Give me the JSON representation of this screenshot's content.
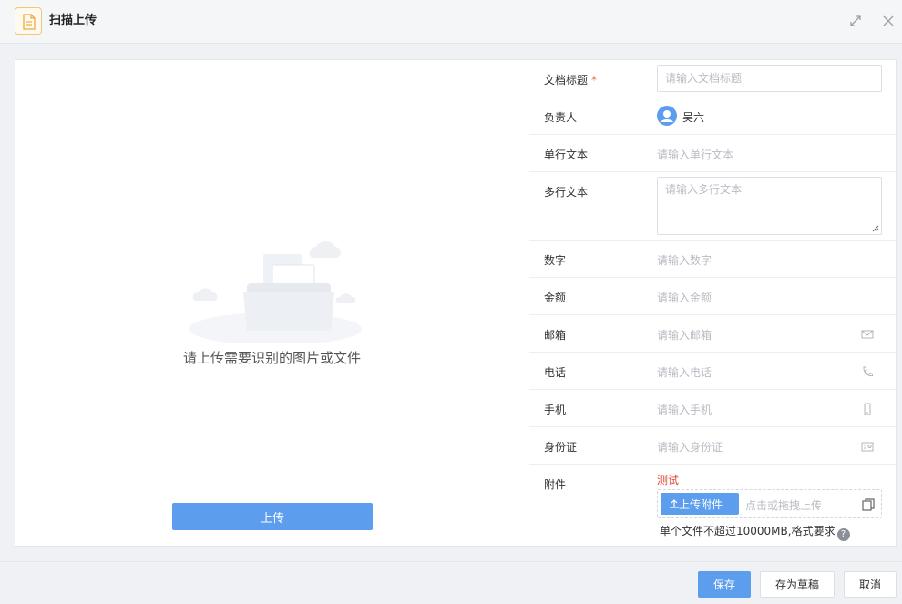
{
  "dialog": {
    "title": "扫描上传"
  },
  "left_panel": {
    "hint": "请上传需要识别的图片或文件",
    "upload_label": "上传"
  },
  "form": {
    "doc_title": {
      "label": "文档标题",
      "required_mark": "*",
      "placeholder": "请输入文档标题"
    },
    "owner": {
      "label": "负责人",
      "value": "吴六"
    },
    "single_text": {
      "label": "单行文本",
      "placeholder": "请输入单行文本"
    },
    "multi_text": {
      "label": "多行文本",
      "placeholder": "请输入多行文本"
    },
    "number": {
      "label": "数字",
      "placeholder": "请输入数字"
    },
    "amount": {
      "label": "金额",
      "placeholder": "请输入金额"
    },
    "email": {
      "label": "邮箱",
      "placeholder": "请输入邮箱"
    },
    "phone": {
      "label": "电话",
      "placeholder": "请输入电话"
    },
    "mobile": {
      "label": "手机",
      "placeholder": "请输入手机"
    },
    "id_card": {
      "label": "身份证",
      "placeholder": "请输入身份证"
    },
    "attachment": {
      "label": "附件",
      "title": "测试",
      "button_label": "上传附件",
      "drop_hint": "点击或拖拽上传",
      "rule": "单个文件不超过10000MB,格式要求",
      "help_glyph": "?"
    }
  },
  "footer": {
    "save_label": "保存",
    "draft_label": "存为草稿",
    "cancel_label": "取消"
  },
  "colors": {
    "primary": "#5c9ded",
    "required": "#ef6a52",
    "attachment_title": "#e0463a"
  },
  "icons": [
    "document-icon",
    "expand-icon",
    "close-icon",
    "user-avatar-icon",
    "mail-icon",
    "phone-icon",
    "mobile-icon",
    "id-card-icon",
    "upload-icon",
    "copy-icon",
    "help-icon"
  ]
}
